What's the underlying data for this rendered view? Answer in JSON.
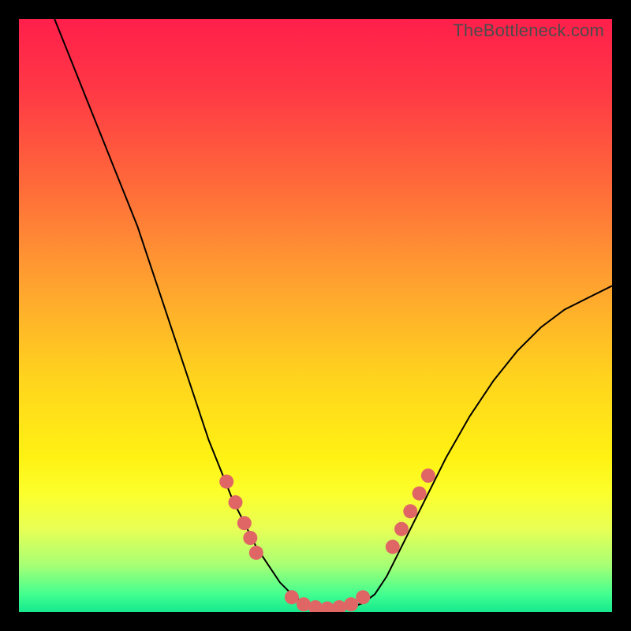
{
  "watermark": "TheBottleneck.com",
  "chart_data": {
    "type": "line",
    "title": "",
    "xlabel": "",
    "ylabel": "",
    "xlim": [
      0,
      100
    ],
    "ylim": [
      0,
      100
    ],
    "grid": false,
    "legend": false,
    "background_gradient": {
      "stops": [
        {
          "offset": 0.0,
          "color": "#ff1f4b"
        },
        {
          "offset": 0.12,
          "color": "#ff3845"
        },
        {
          "offset": 0.28,
          "color": "#ff6a3a"
        },
        {
          "offset": 0.44,
          "color": "#ffa030"
        },
        {
          "offset": 0.6,
          "color": "#ffd21e"
        },
        {
          "offset": 0.74,
          "color": "#fff213"
        },
        {
          "offset": 0.8,
          "color": "#fbff2c"
        },
        {
          "offset": 0.86,
          "color": "#e8ff55"
        },
        {
          "offset": 0.92,
          "color": "#a8ff74"
        },
        {
          "offset": 0.97,
          "color": "#42ff90"
        },
        {
          "offset": 1.0,
          "color": "#16e88e"
        }
      ]
    },
    "series": [
      {
        "name": "bottleneck-curve",
        "color": "#000000",
        "x": [
          6,
          8,
          10,
          12,
          14,
          16,
          18,
          20,
          22,
          24,
          26,
          28,
          30,
          32,
          34,
          36,
          38,
          40,
          42,
          44,
          46,
          48,
          50,
          52,
          54,
          56,
          58,
          60,
          62,
          64,
          68,
          72,
          76,
          80,
          84,
          88,
          92,
          96,
          100
        ],
        "y": [
          100,
          95,
          90,
          85,
          80,
          75,
          70,
          65,
          59,
          53,
          47,
          41,
          35,
          29,
          24,
          19,
          15,
          11,
          8,
          5,
          3,
          1.5,
          0.8,
          0.5,
          0.5,
          0.8,
          1.5,
          3,
          6,
          10,
          18,
          26,
          33,
          39,
          44,
          48,
          51,
          53,
          55
        ]
      }
    ],
    "markers": {
      "name": "highlight-dots",
      "color": "#e06666",
      "radius": 9,
      "points": [
        {
          "x": 35,
          "y": 22
        },
        {
          "x": 36.5,
          "y": 18.5
        },
        {
          "x": 38,
          "y": 15
        },
        {
          "x": 39,
          "y": 12.5
        },
        {
          "x": 40,
          "y": 10
        },
        {
          "x": 46,
          "y": 2.5
        },
        {
          "x": 48,
          "y": 1.3
        },
        {
          "x": 50,
          "y": 0.8
        },
        {
          "x": 52,
          "y": 0.6
        },
        {
          "x": 54,
          "y": 0.8
        },
        {
          "x": 56,
          "y": 1.3
        },
        {
          "x": 58,
          "y": 2.5
        },
        {
          "x": 63,
          "y": 11
        },
        {
          "x": 64.5,
          "y": 14
        },
        {
          "x": 66,
          "y": 17
        },
        {
          "x": 67.5,
          "y": 20
        },
        {
          "x": 69,
          "y": 23
        }
      ]
    }
  }
}
